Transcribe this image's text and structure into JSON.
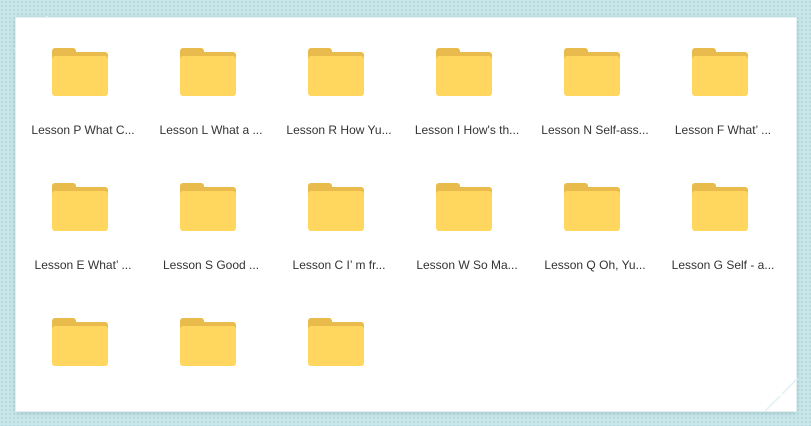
{
  "window": {
    "items": [
      {
        "label": "Lesson P What C...",
        "icon": "folder-icon"
      },
      {
        "label": "Lesson L What a ...",
        "icon": "folder-icon"
      },
      {
        "label": "Lesson R How Yu...",
        "icon": "folder-icon"
      },
      {
        "label": "Lesson I How's th...",
        "icon": "folder-icon"
      },
      {
        "label": "Lesson N Self-ass...",
        "icon": "folder-icon"
      },
      {
        "label": "Lesson F What’ ...",
        "icon": "folder-icon"
      },
      {
        "label": "Lesson E What’ ...",
        "icon": "folder-icon"
      },
      {
        "label": "Lesson S Good ...",
        "icon": "folder-icon"
      },
      {
        "label": "Lesson C I’ m fr...",
        "icon": "folder-icon"
      },
      {
        "label": "Lesson W So Ma...",
        "icon": "folder-icon"
      },
      {
        "label": "Lesson Q Oh, Yu...",
        "icon": "folder-icon"
      },
      {
        "label": "Lesson G Self - a...",
        "icon": "folder-icon"
      },
      {
        "label": "",
        "icon": "folder-icon"
      },
      {
        "label": "",
        "icon": "folder-icon"
      },
      {
        "label": "",
        "icon": "folder-icon"
      }
    ]
  },
  "colors": {
    "background": "#c9e7ea",
    "folder_front": "#ffd65e",
    "folder_back": "#e8bb4c"
  }
}
